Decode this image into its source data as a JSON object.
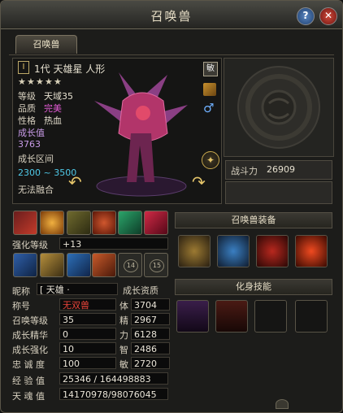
{
  "window": {
    "title": "召唤兽"
  },
  "tabs": [
    {
      "label": "召唤兽"
    }
  ],
  "pet": {
    "name_line": "1代 天雄星 人形",
    "level_label": "等级",
    "level_value": "天域35",
    "quality_label": "品质",
    "quality_value": "完美",
    "personality_label": "性格",
    "personality_value": "热血",
    "growth_label": "成长值",
    "growth_value": "3763",
    "growth_range_label": "成长区间",
    "growth_range_value": "2300 ~ 3500",
    "fuse_label": "无法融合",
    "rarity_badge": "敏",
    "stars": 5
  },
  "combat": {
    "label": "战斗力",
    "value": "26909"
  },
  "enhance": {
    "label": "强化等级",
    "value": "+13",
    "slot_14": "14",
    "slot_15": "15"
  },
  "equip_header": "召唤兽装备",
  "skill_header": "化身技能",
  "nickname": {
    "label": "昵称",
    "value": "[ 天雄 ·",
    "growth_apt": "成长资质"
  },
  "left_stats": [
    {
      "label": "称号",
      "value": "无双兽"
    },
    {
      "label": "召唤等级",
      "value": "35"
    },
    {
      "label": "成长精华",
      "value": "0"
    },
    {
      "label": "成长强化",
      "value": "10"
    },
    {
      "label": "忠 诚 度",
      "value": "100"
    }
  ],
  "right_stats": [
    {
      "label": "体",
      "value": "3704"
    },
    {
      "label": "精",
      "value": "2967"
    },
    {
      "label": "力",
      "value": "6128"
    },
    {
      "label": "智",
      "value": "2486"
    },
    {
      "label": "敏",
      "value": "2720"
    }
  ],
  "experience": {
    "label": "经 验 值",
    "value": "25346 / 164498883"
  },
  "soul": {
    "label": "天 魂 值",
    "value": "14170978/98076045"
  },
  "colors": {
    "accent": "#e6c66b",
    "quality": "#e25ad5",
    "title_red": "#e8443a",
    "range": "#4fc9e8"
  }
}
